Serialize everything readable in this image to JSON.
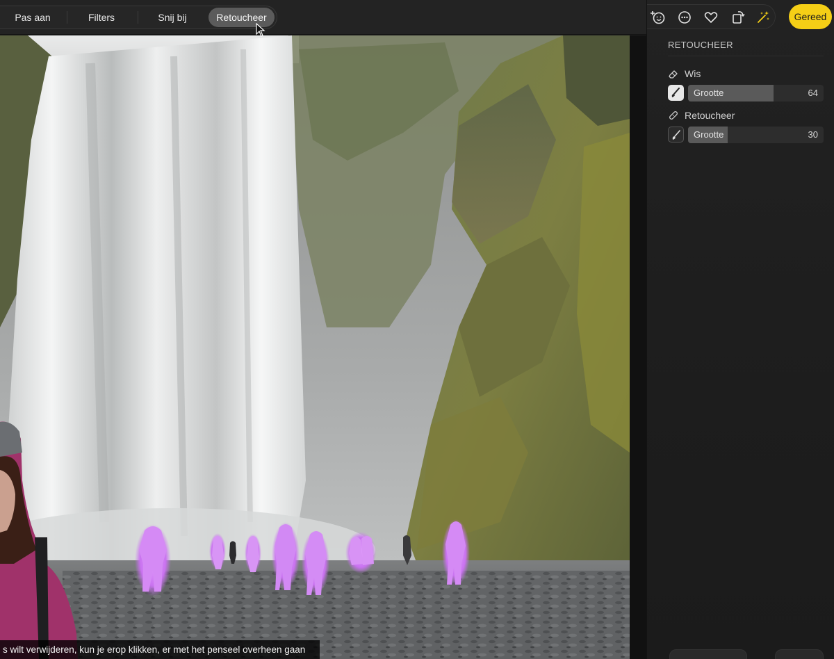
{
  "toolbar": {
    "tabs": [
      {
        "label": "Pas aan"
      },
      {
        "label": "Filters"
      },
      {
        "label": "Snij bij"
      },
      {
        "label": "Retoucheer"
      }
    ],
    "active_tab": "Retoucheer"
  },
  "actions": {
    "icons": [
      "face-add-icon",
      "more-icon",
      "heart-icon",
      "rotate-icon",
      "magic-wand-icon"
    ],
    "done_label": "Gereed",
    "accent_color": "#f5cf16",
    "highlight_color": "#d98bff"
  },
  "panel": {
    "title": "RETOUCHEER",
    "tools": [
      {
        "label": "Wis",
        "icon": "eraser-icon",
        "slider_label": "Grootte",
        "value": "64",
        "fill_fraction": 0.63
      },
      {
        "label": "Retoucheer",
        "icon": "bandage-icon",
        "slider_label": "Grootte",
        "value": "30",
        "fill_fraction": 0.29
      }
    ]
  },
  "caption": {
    "text": "s wilt verwijderen, kun je erop klikken, er met het penseel overheen gaan"
  }
}
